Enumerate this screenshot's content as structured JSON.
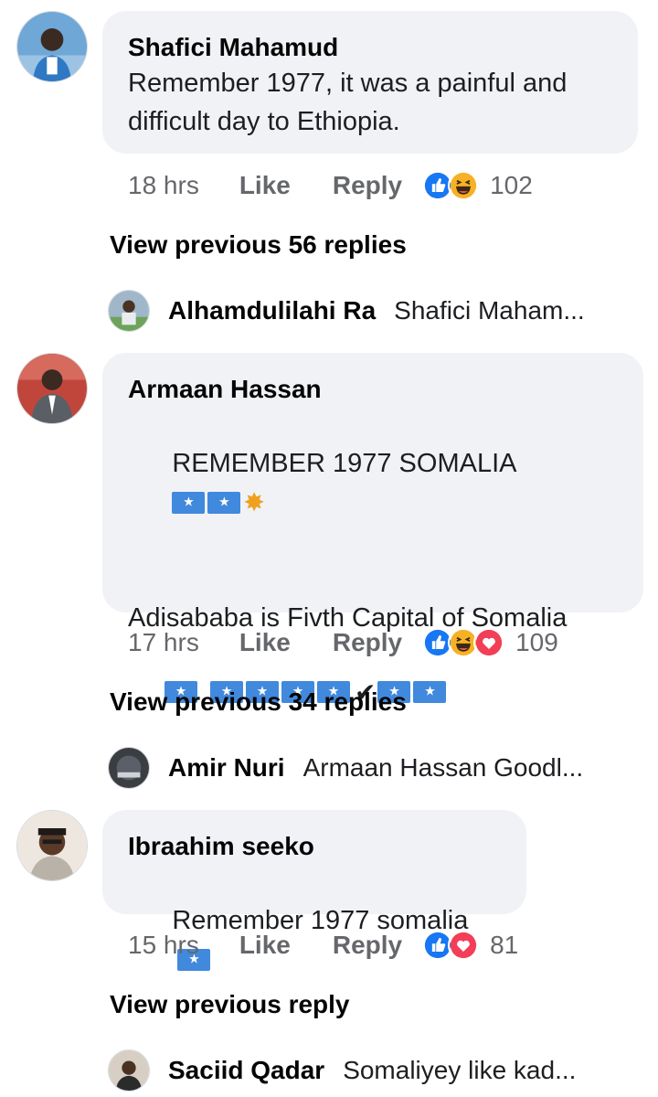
{
  "comments": [
    {
      "author": "Shafici Mahamud",
      "text": "Remember 1977, it was a painful and difficult day to Ethiopia.",
      "time": "18 hrs",
      "like_label": "Like",
      "reply_label": "Reply",
      "reactions": [
        "like",
        "haha"
      ],
      "reaction_count": "102",
      "view_previous": "View previous 56 replies",
      "reply_preview": {
        "name": "Alhamdulilahi Ra",
        "text": "Shafici Maham..."
      }
    },
    {
      "author": "Armaan Hassan",
      "text_line1": "REMEMBER 1977 SOMALIA",
      "text_line2": "Adisababa is Fivth Capital of Somalia",
      "checkmark": "✔",
      "time": "17 hrs",
      "like_label": "Like",
      "reply_label": "Reply",
      "reactions": [
        "like",
        "haha",
        "love"
      ],
      "reaction_count": "109",
      "view_previous": "View previous 34 replies",
      "reply_preview": {
        "name": "Amir Nuri",
        "text": "Armaan Hassan Goodl..."
      }
    },
    {
      "author": "Ibraahim seeko",
      "text": "Remember 1977 somalia",
      "time": "15 hrs",
      "like_label": "Like",
      "reply_label": "Reply",
      "reactions": [
        "like",
        "love"
      ],
      "reaction_count": "81",
      "view_previous": "View previous reply",
      "reply_preview": {
        "name": "Saciid Qadar",
        "text": "Somaliyey like kad..."
      }
    }
  ],
  "colors": {
    "bubble": "#f0f2f5",
    "meta": "#65676b",
    "like_blue": "#1877f2",
    "love_red": "#f33e58",
    "haha_yellow": "#f7b125",
    "flag_blue": "#4189dd"
  }
}
